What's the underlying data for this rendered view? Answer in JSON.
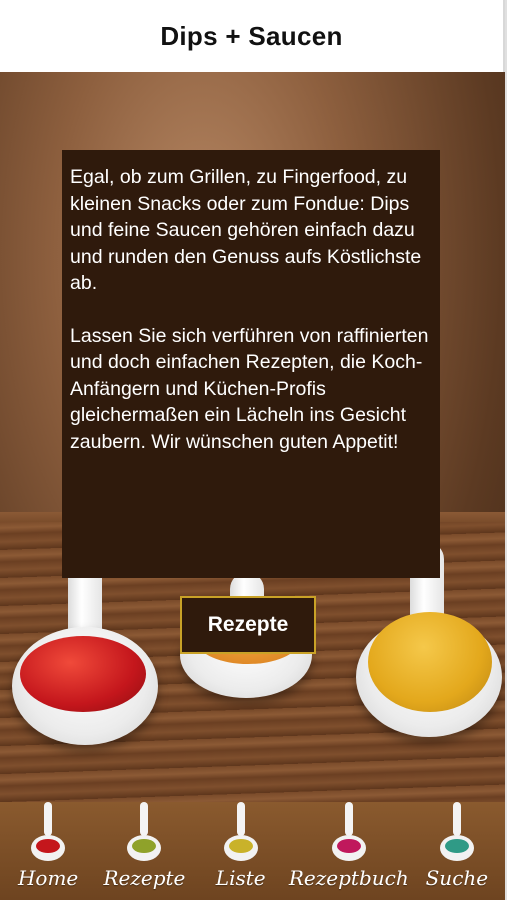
{
  "header": {
    "title": "Dips + Saucen"
  },
  "intro": {
    "paragraph1": "Egal, ob zum Grillen, zu Fingerfood, zu kleinen Snacks oder zum Fondue: Dips und feine Saucen gehören einfach dazu und runden den Genuss aufs Köstlichste ab.",
    "paragraph2": "Lassen Sie sich verführen von raffinierten und doch einfachen Rezepten, die Koch-Anfängern und Küchen-Profis gleichermaßen ein Lächeln ins Gesicht zaubern. Wir wünschen guten Appetit!"
  },
  "cta": {
    "label": "Rezepte"
  },
  "tabbar": {
    "items": [
      {
        "label": "Home",
        "icon": "spoon-red-sauce-icon",
        "sauce_color": "#c4161c"
      },
      {
        "label": "Rezepte",
        "icon": "spoon-green-sauce-icon",
        "sauce_color": "#8fa22a"
      },
      {
        "label": "Liste",
        "icon": "spoon-yellow-sauce-icon",
        "sauce_color": "#c9b22a"
      },
      {
        "label": "Rezeptbuch",
        "icon": "spoon-pink-sauce-icon",
        "sauce_color": "#c0185c"
      },
      {
        "label": "Suche",
        "icon": "spoon-teal-sauce-icon",
        "sauce_color": "#2f9a86"
      }
    ]
  },
  "colors": {
    "panel": "#2f1a0c",
    "button_border": "#c9a227",
    "tabbar": "#7a4d25"
  }
}
